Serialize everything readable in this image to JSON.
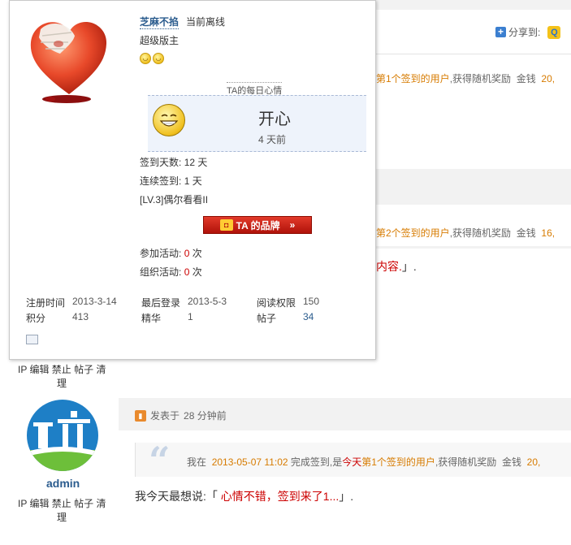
{
  "share": {
    "label": "分享到:"
  },
  "profile_card": {
    "username": "芝麻不掐",
    "status": "当前离线",
    "group": "超级版主",
    "mood": {
      "title": "TA的每日心情",
      "text": "开心",
      "time": "4 天前"
    },
    "stats": {
      "sign_days_label": "签到天数:",
      "sign_days_value": "12 天",
      "streak_label": "连续签到:",
      "streak_value": "1 天",
      "level": "[LV.3]偶尔看看II"
    },
    "brand_button": {
      "label": "TA 的品牌",
      "arrow": "»"
    },
    "activity": {
      "join_label": "参加活动:",
      "join_value": "0",
      "join_unit": "次",
      "organize_label": "组织活动:",
      "organize_value": "0",
      "organize_unit": "次"
    },
    "info": {
      "reg_time_label": "注册时间",
      "reg_time_value": "2013-3-14",
      "last_login_label": "最后登录",
      "last_login_value": "2013-5-3",
      "read_perm_label": "阅读权限",
      "read_perm_value": "150",
      "points_label": "积分",
      "points_value": "413",
      "digest_label": "精华",
      "digest_value": "1",
      "posts_label": "帖子",
      "posts_value": "34"
    }
  },
  "background_posts": {
    "line1": {
      "prefix": "第1个签到的用户",
      "mid": ",获得随机奖励",
      "coin_label": "金钱",
      "coin_value": "20,"
    },
    "line2": {
      "prefix": "第2个签到的用户",
      "mid": ",获得随机奖励",
      "coin_label": "金钱",
      "coin_value": "16,"
    },
    "line3": {
      "text": "内容.",
      "tail": "」."
    }
  },
  "admin_links_1": {
    "line1": "IP 编辑 禁止 帖子 清",
    "line2": "理"
  },
  "post2": {
    "author": "admin",
    "posted_label": "发表于",
    "posted_time": "28 分钟前",
    "quote": {
      "p1": "我在",
      "datetime": "2013-05-07 11:02",
      "p2": "完成签到,是",
      "today": "今天",
      "rank": "第1个签到的用户",
      "p3": ",获得随机奖励",
      "coin_label": "金钱",
      "coin_value": "20,"
    },
    "say": {
      "prefix": "我今天最想说:「",
      "text": "心情不错，签到来了1...",
      "suffix": "」."
    },
    "admin_links": {
      "line1": "IP 编辑 禁止 帖子 清",
      "line2": "理"
    }
  },
  "colors": {
    "accent_red": "#cc0000",
    "link_blue": "#2b5c8e",
    "orange": "#d77b00"
  }
}
